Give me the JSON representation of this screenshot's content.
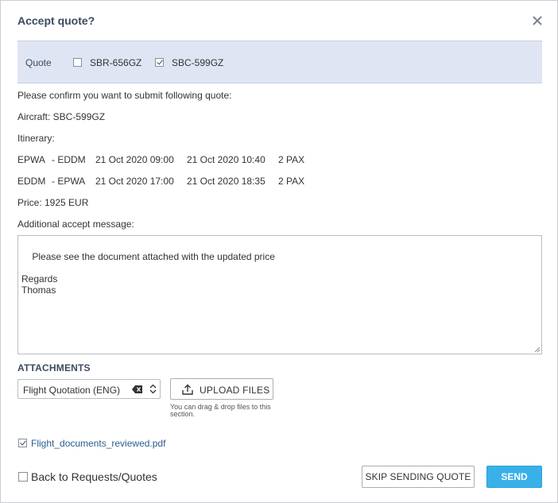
{
  "dialog": {
    "title": "Accept quote?",
    "close_icon": "close-icon"
  },
  "quote_selector": {
    "label": "Quote",
    "options": [
      {
        "label": "SBR-656GZ",
        "checked": false
      },
      {
        "label": "SBC-599GZ",
        "checked": true
      }
    ]
  },
  "summary": {
    "confirm_text": "Please confirm you want to submit following quote:",
    "aircraft": "Aircraft: SBC-599GZ",
    "itinerary_label": "Itinerary:",
    "legs": [
      {
        "from": "EPWA",
        "to": "- EDDM",
        "departure": "21 Oct 2020 09:00",
        "arrival": "21 Oct 2020 10:40",
        "pax": "2 PAX"
      },
      {
        "from": "EDDM",
        "to": "- EPWA",
        "departure": "21 Oct 2020 17:00",
        "arrival": "21 Oct 2020 18:35",
        "pax": "2 PAX"
      }
    ],
    "price": "Price: 1925 EUR"
  },
  "message": {
    "label": "Additional accept message:",
    "value": "Please see the document attached with the updated price\n\nRegards\nThomas"
  },
  "attachments": {
    "heading": "ATTACHMENTS",
    "template_select": "Flight Quotation (ENG)",
    "upload_label": "UPLOAD FILES",
    "drop_hint": "You can drag & drop files to this section.",
    "files": [
      {
        "name": "Flight_documents_reviewed.pdf",
        "checked": true
      }
    ]
  },
  "footer": {
    "back_label": "Back to Requests/Quotes",
    "back_checked": false,
    "skip_label": "SKIP SENDING QUOTE",
    "send_label": "SEND"
  },
  "colors": {
    "title": "#3c4b5e",
    "quote_bar_bg": "#dfe5f3",
    "link": "#2a5d8f",
    "send_bg": "#39b1e8"
  }
}
